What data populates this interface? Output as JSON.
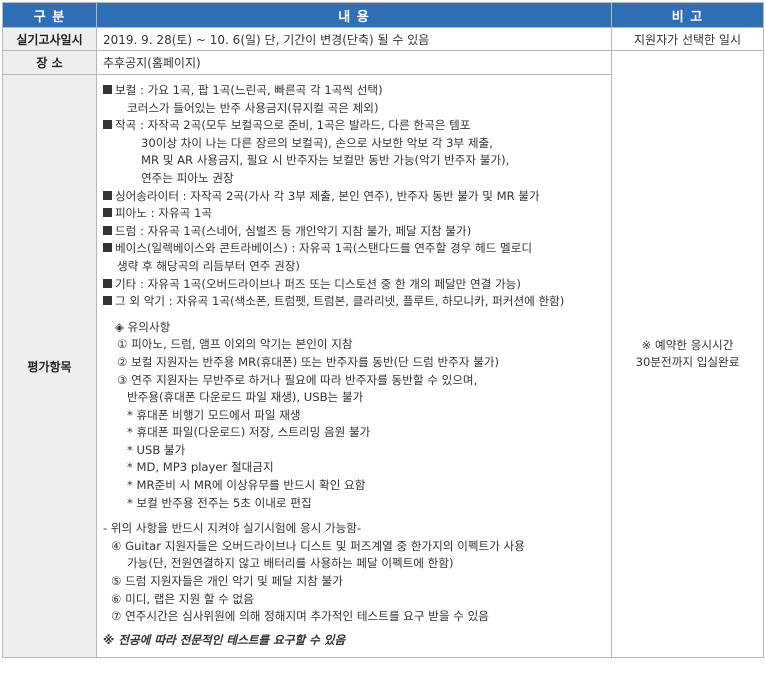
{
  "header": {
    "col1": "구 분",
    "col2": "내 용",
    "col3": "비 고"
  },
  "rows": {
    "date": {
      "label": "실기고사일시",
      "content": "2019. 9. 28(토) ~ 10. 6(일) 단, 기간이 변경(단축) 될 수 있음",
      "note": "지원자가 선택한 일시"
    },
    "place": {
      "label": "장 소",
      "content": "추후공지(홈페이지)"
    },
    "eval": {
      "label": "평가항목",
      "note1": "※ 예약한 응시시간",
      "note2": "30분전까지 입실완료",
      "vocal1": "보컬 : 가요 1곡, 팝 1곡(느린곡,  빠른곡 각 1곡씩 선택)",
      "vocal2": "코러스가 들어있는 반주 사용금지(뮤지컬 곡은 제외)",
      "comp1": "작곡 : 자작곡 2곡(모두 보컬곡으로 준비, 1곡은 발라드, 다른 한곡은 템포",
      "comp2": "30이상 차이 나는 다른 장르의 보컬곡), 손으로 사보한 악보 각 3부 제출,",
      "comp3": "MR 및 AR 사용금지, 필요 시 반주자는 보컬만 동반 가능(악기 반주자 불가),",
      "comp4": "연주는 피아노 권장",
      "singer": "싱어송라이터 : 자작곡 2곡(가사 각 3부 제출, 본인 연주), 반주자 동반 불가 및 MR 불가",
      "piano": "피아노 : 자유곡 1곡",
      "drum": "드럼 : 자유곡 1곡(스네어, 심벌즈 등 개인악기 지참 불가, 페달 지참 불가)",
      "bass1": "베이스(일렉베이스와 콘트라베이스) : 자유곡 1곡(스탠다드를 연주할 경우 헤드 멜로디",
      "bass2": "생략 후 해당곡의 리듬부터 연주 권장)",
      "guitar": "기타 : 자유곡 1곡(오버드라이브나 퍼즈 또는 디스토션 중 한 개의 페달만 연결 가능)",
      "other": "그 외 악기 : 자유곡 1곡(색소폰, 트럼펫, 트럼본, 클라리넷, 플루트, 하모니카, 퍼커션에 한함)",
      "caution_title": "유의사항",
      "c1": "① 피아노, 드럼, 앰프 이외의 악기는 본인이 지참",
      "c2": "② 보컬 지원자는 반주용 MR(휴대폰) 또는 반주자를 동반(단 드럼 반주자 불가)",
      "c3a": "③ 연주 지원자는 무반주로 하거나 필요에 따라 반주자를 동반할 수 있으며,",
      "c3b": "반주용(휴대폰 다운로드 파일 재생), USB는 불가",
      "s1": "* 휴대폰 비행기 모드에서 파일 재생",
      "s2": "* 휴대폰 파일(다운로드) 저장, 스트리밍 음원 불가",
      "s3": "* USB 불가",
      "s4": "* MD, MP3 player 절대금지",
      "s5": "* MR준비 시 MR에 이상유무를 반드시 확인 요함",
      "s6": "* 보컬 반주용 전주는 5초 이내로 편집",
      "must": "- 위의 사항을 반드시 지켜야 실기시험에 응시 가능함-",
      "c4a": "④ Guitar 지원자들은 오버드라이브나 디스트 및 퍼즈계열 중 한가지의 이펙트가 사용",
      "c4b": "가능(단, 전원연결하지 않고 배터리를 사용하는 페달 이펙트에 한함)",
      "c5": "⑤ 드럼 지원자들은 개인 악기 및 페달 지참 불가",
      "c6": "⑥ 미디, 랩은 지원 할 수 없음",
      "c7": "⑦ 연주시간은 심사위원에 의해 정해지며 추가적인 테스트를 요구 받을 수 있음",
      "bottom": "※ 전공에 따라 전문적인 테스트를 요구할 수 있음"
    }
  }
}
